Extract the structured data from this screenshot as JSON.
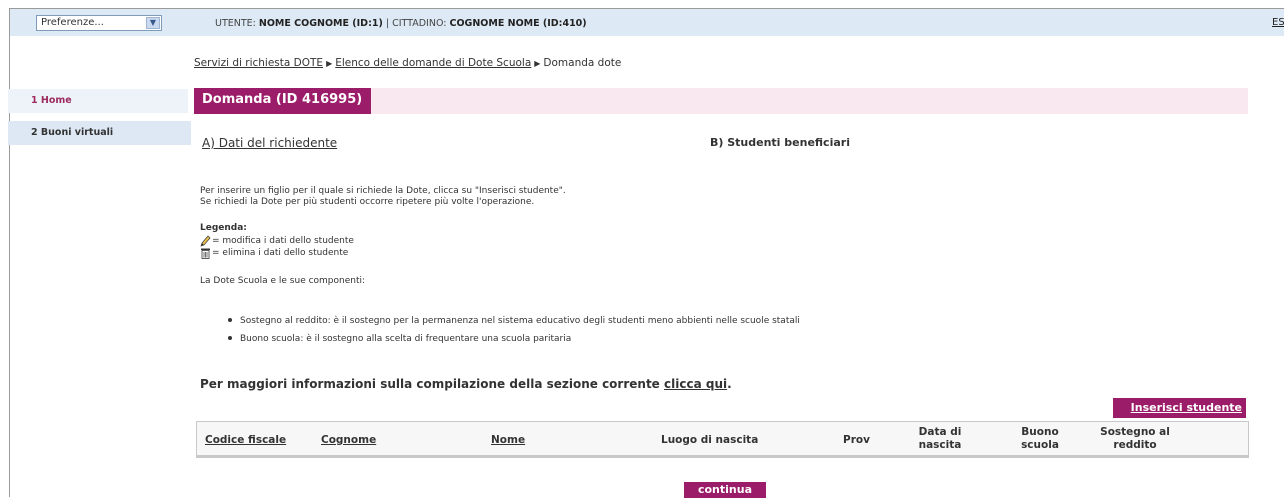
{
  "topbar": {
    "preferences_value": "Preferenze...",
    "user_label": "UTENTE:",
    "user_value": "NOME COGNOME (ID:1)",
    "separator": "|",
    "citizen_label": "CITTADINO:",
    "citizen_value": "COGNOME NOME (ID:410)",
    "exit_label": "ESC"
  },
  "breadcrumb": {
    "items": [
      "Servizi di richiesta DOTE",
      "Elenco delle domande di Dote Scuola",
      "Domanda dote"
    ]
  },
  "sidebar": {
    "items": [
      {
        "label": "1 Home"
      },
      {
        "label": "2 Buoni virtuali"
      }
    ]
  },
  "page": {
    "title": "Domanda (ID 416995)",
    "tab_a": "A) Dati del richiedente",
    "tab_b": "B) Studenti beneficiari",
    "info_line1": "Per inserire un figlio per il quale si richiede la Dote, clicca su \"Inserisci studente\".",
    "info_line2": "Se richiedi la Dote per più studenti occorre ripetere più volte l'operazione.",
    "legend_title": "Legenda:",
    "legend_edit": "= modifica i dati dello studente",
    "legend_delete": "= elimina i dati dello studente",
    "components_title": "La Dote Scuola e le sue componenti:",
    "bullets": [
      "Sostegno al reddito: è il sostegno per la permanenza nel sistema educativo degli studenti meno abbienti nelle scuole statali",
      "Buono scuola: è il sostegno alla scelta di frequentare una scuola paritaria"
    ],
    "more_info_text": "Per maggiori informazioni sulla compilazione della sezione corrente",
    "more_info_link": "clicca qui",
    "more_info_end": ".",
    "insert_button": "Inserisci studente",
    "continue_button": "continua"
  },
  "table": {
    "headers": {
      "codice_fiscale": "Codice fiscale",
      "cognome": "Cognome",
      "nome": "Nome",
      "luogo": "Luogo di nascita",
      "prov": "Prov",
      "data_1": "Data di",
      "data_2": "nascita",
      "buono_1": "Buono",
      "buono_2": "scuola",
      "sostegno_1": "Sostegno al",
      "sostegno_2": "reddito"
    }
  },
  "colors": {
    "accent": "#9b1c68",
    "topbar": "#dde9f5",
    "titlebar_bg": "#f9e8f0"
  },
  "icons": [
    "chevron-down-icon",
    "pencil-icon",
    "trash-icon",
    "triangle-right-icon"
  ]
}
